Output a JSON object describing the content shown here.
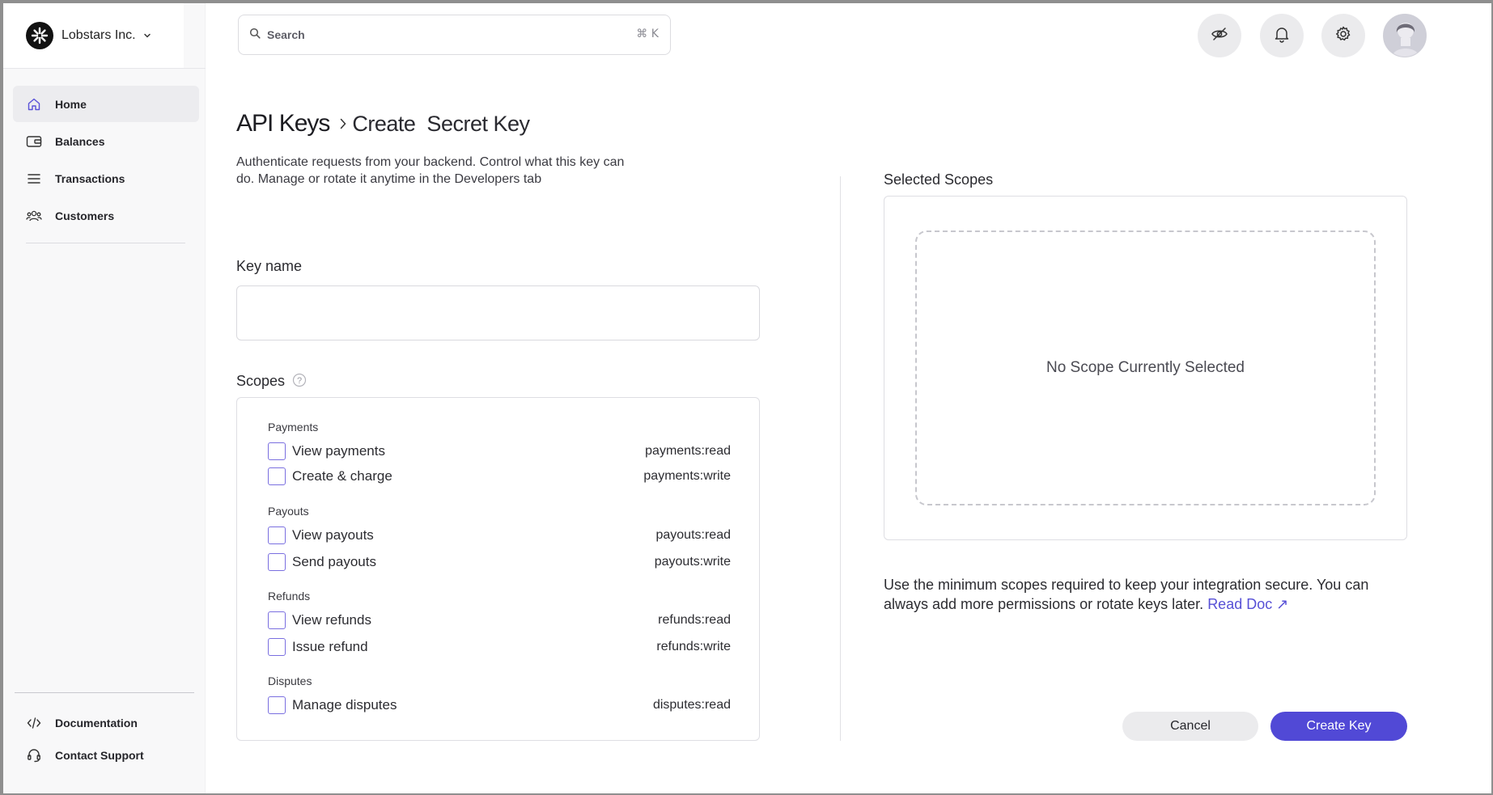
{
  "org": {
    "name": "Lobstars Inc."
  },
  "nav": {
    "items": [
      {
        "label": "Home",
        "icon": "home-icon"
      },
      {
        "label": "Balances",
        "icon": "wallet-icon"
      },
      {
        "label": "Transactions",
        "icon": "list-icon"
      },
      {
        "label": "Customers",
        "icon": "users-icon"
      }
    ],
    "bottom": [
      {
        "label": "Documentation",
        "icon": "code-icon"
      },
      {
        "label": "Contact Support",
        "icon": "headset-icon"
      }
    ]
  },
  "topbar": {
    "search_placeholder": "Search",
    "search_shortcut": "⌘ K"
  },
  "page": {
    "breadcrumb_root": "API Keys",
    "breadcrumb_current": "Create  Secret Key",
    "subtitle": "Authenticate requests from your backend. Control what this key can do. Manage or rotate it anytime in the Developers tab"
  },
  "form": {
    "key_name_label": "Key name",
    "key_name_value": "",
    "scopes_label": "Scopes"
  },
  "scope_groups": [
    {
      "title": "Payments",
      "scopes": [
        {
          "label": "View payments",
          "code": "payments:read",
          "checked": false
        },
        {
          "label": "Create & charge",
          "code": "payments:write",
          "checked": false
        }
      ]
    },
    {
      "title": "Payouts",
      "scopes": [
        {
          "label": "View payouts",
          "code": "payouts:read",
          "checked": false
        },
        {
          "label": "Send payouts",
          "code": "payouts:write",
          "checked": false
        }
      ]
    },
    {
      "title": "Refunds",
      "scopes": [
        {
          "label": "View refunds",
          "code": "refunds:read",
          "checked": false
        },
        {
          "label": "Issue refund",
          "code": "refunds:write",
          "checked": false
        }
      ]
    },
    {
      "title": "Disputes",
      "scopes": [
        {
          "label": "Manage disputes",
          "code": "disputes:read",
          "checked": false
        }
      ]
    }
  ],
  "selected": {
    "title": "Selected Scopes",
    "empty_text": "No Scope Currently Selected"
  },
  "hint": {
    "text": "Use the minimum scopes required to keep your integration secure. You can always add more permissions or rotate keys later.",
    "link_label": "Read Doc ↗"
  },
  "actions": {
    "cancel_label": "Cancel",
    "create_label": "Create Key"
  },
  "colors": {
    "accent": "#5149d6",
    "checkbox_border": "#7a6fe0"
  }
}
